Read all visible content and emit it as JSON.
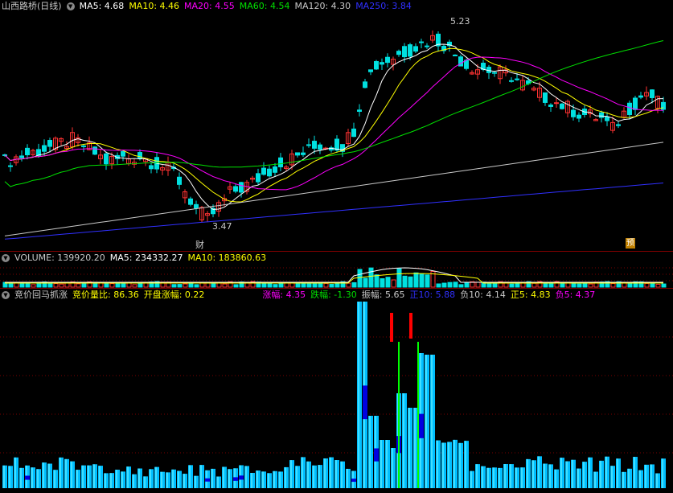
{
  "header_main": {
    "title": "山西路桥(日线)",
    "toggle_icon": "circle-down-icon",
    "ma5": "MA5: 4.68",
    "ma10": "MA10: 4.46",
    "ma20": "MA20: 4.55",
    "ma60": "MA60: 4.54",
    "ma120": "MA120: 4.30",
    "ma250": "MA250: 3.84"
  },
  "annotations": {
    "high_price": "5.23",
    "low_price": "3.47",
    "marker_cai": "财",
    "marker_yu": "预"
  },
  "header_volume": {
    "toggle_icon": "circle-down-icon",
    "volume": "VOLUME: 139920.20",
    "ma5": "MA5: 234332.27",
    "ma10": "MA10: 183860.63"
  },
  "header_indicator": {
    "toggle_icon": "circle-down-icon",
    "name": "竞价回马抓涨",
    "auction_ratio": "竞价量比: 86.36",
    "open_change": "开盘涨幅: 0.22",
    "rise": "涨幅: 4.35",
    "fall": "跌幅: -1.30",
    "amplitude": "振幅: 5.65",
    "pos10": "正10: 5.88",
    "neg10": "负10: 4.14",
    "pos5": "正5: 4.83",
    "neg5": "负5: 4.37"
  },
  "colors": {
    "background": "#000000",
    "up": "#ff3232",
    "down": "#00e0e0",
    "ma5": "#ffffff",
    "ma10": "#ffff00",
    "ma20": "#ff00ff",
    "ma60": "#00e000",
    "ma120": "#c8c8c8",
    "ma250": "#3030ff",
    "bar": "#00bfff",
    "bar_dark": "#0000e0",
    "signal_green": "#00ff00",
    "signal_red": "#ff0000"
  }
}
